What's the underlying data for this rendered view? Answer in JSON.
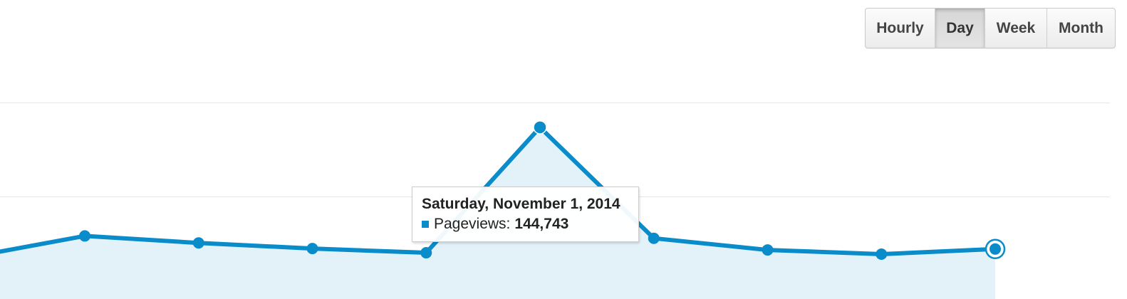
{
  "range_selector": {
    "buttons": [
      {
        "label": "Hourly",
        "active": false
      },
      {
        "label": "Day",
        "active": true
      },
      {
        "label": "Week",
        "active": false
      },
      {
        "label": "Month",
        "active": false
      }
    ]
  },
  "colors": {
    "series": "#0a8ccb",
    "area_fill": "#e3f2f8",
    "gridline": "#e6e6e6"
  },
  "tooltip": {
    "date": "Saturday, November 1, 2014",
    "series_name": "Pageviews:",
    "value": "144,743"
  },
  "chart_data": {
    "type": "area",
    "series": [
      {
        "name": "Pageviews",
        "values": [
          {
            "x": -1,
            "y": 117000
          },
          {
            "x": 0,
            "y": 121500
          },
          {
            "x": 1,
            "y": 120000
          },
          {
            "x": 2,
            "y": 118800
          },
          {
            "x": 3,
            "y": 117900
          },
          {
            "x": 4,
            "y": 144743
          },
          {
            "x": 5,
            "y": 121000
          },
          {
            "x": 6,
            "y": 118500
          },
          {
            "x": 7,
            "y": 117600
          },
          {
            "x": 8,
            "y": 118700
          }
        ]
      }
    ],
    "highlighted_index": 4,
    "selected_index": 8,
    "ylim": [
      108000,
      172000
    ],
    "gridlines": [
      150000,
      130000
    ],
    "grid": true,
    "legend": "none"
  }
}
